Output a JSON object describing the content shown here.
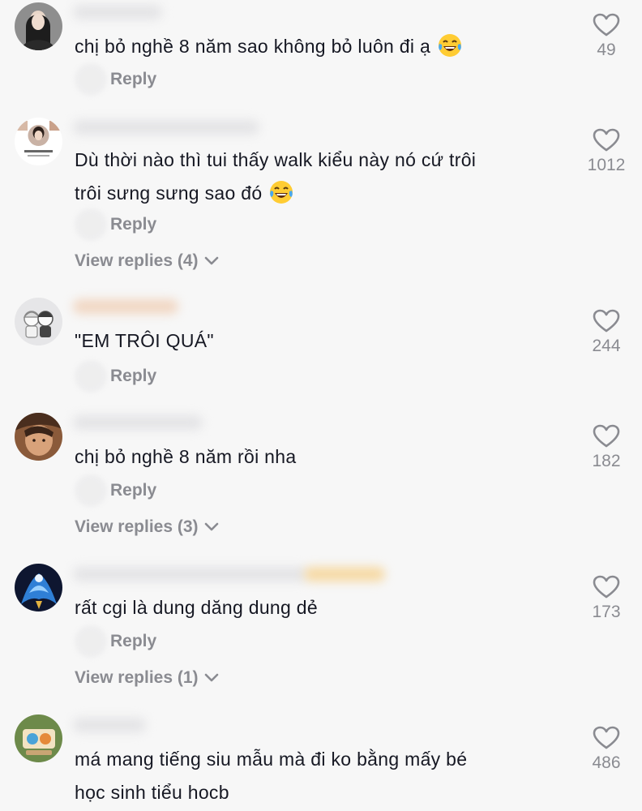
{
  "comments": [
    {
      "text": "chị bỏ nghề 8 năm sao không bỏ luôn đi ạ",
      "emoji": "laughing-tears-emoji",
      "reply_label": "Reply",
      "likes": "49"
    },
    {
      "text_line1": "Dù thời nào thì tui thấy walk kiểu này nó cứ trôi",
      "text_line2": "trôi sưng sưng sao đó",
      "emoji": "laughing-tears-emoji",
      "reply_label": "Reply",
      "view_replies": "View replies (4)",
      "likes": "1012"
    },
    {
      "text": "\"EM TRÔI QUÁ\"",
      "reply_label": "Reply",
      "likes": "244"
    },
    {
      "text": "chị bỏ nghề 8 năm rồi nha",
      "reply_label": "Reply",
      "view_replies": "View replies (3)",
      "likes": "182"
    },
    {
      "text": "rất cgi là dung dăng dung dẻ",
      "reply_label": "Reply",
      "view_replies": "View replies (1)",
      "likes": "173"
    },
    {
      "text_line1": "má mang tiếng siu mẫu mà đi ko bằng mấy bé",
      "text_line2": "học sinh tiểu hocb",
      "likes": "486"
    }
  ],
  "icons": {
    "like": "heart-outline-icon",
    "expand": "chevron-down-icon"
  },
  "colors": {
    "background": "#f7f7f7",
    "text": "#161823",
    "muted": "#8a8b91"
  }
}
